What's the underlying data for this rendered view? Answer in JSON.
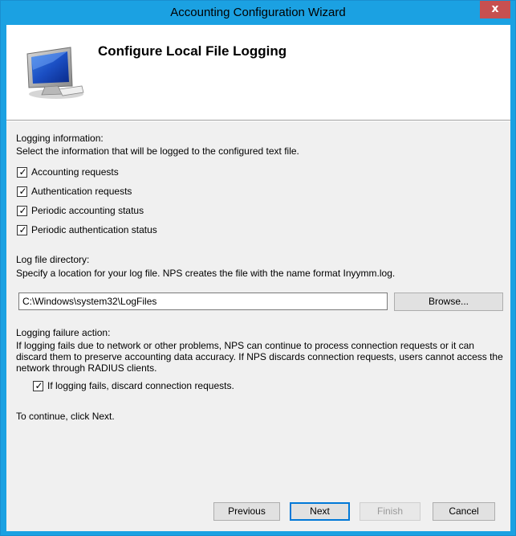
{
  "window": {
    "title": "Accounting Configuration Wizard",
    "close_glyph": "x"
  },
  "header": {
    "heading": "Configure Local File Logging",
    "icon": "monitor-icon"
  },
  "logging_info": {
    "label": "Logging information:",
    "description": "Select the information that will be logged to the configured text file.",
    "options": [
      {
        "label": "Accounting requests",
        "checked": true
      },
      {
        "label": "Authentication requests",
        "checked": true
      },
      {
        "label": "Periodic accounting status",
        "checked": true
      },
      {
        "label": "Periodic authentication status",
        "checked": true
      }
    ]
  },
  "log_dir": {
    "label": "Log file directory:",
    "description": "Specify a location for your log file. NPS creates the file with the name format Inyymm.log.",
    "value": "C:\\Windows\\system32\\LogFiles",
    "browse_label": "Browse..."
  },
  "failure": {
    "label": "Logging failure action:",
    "description": "If logging fails due to network or other problems, NPS can  continue to process connection requests or it can discard them to preserve accounting data accuracy. If NPS discards connection requests, users cannot access the network through RADIUS clients.",
    "option_label": "If logging fails, discard connection requests.",
    "option_checked": true
  },
  "continue_text": "To continue, click Next.",
  "buttons": {
    "previous": "Previous",
    "next": "Next",
    "finish": "Finish",
    "cancel": "Cancel"
  },
  "colors": {
    "titlebar": "#1ba1e2",
    "close_button": "#c75050",
    "dialog_background": "#f0f0f0"
  }
}
